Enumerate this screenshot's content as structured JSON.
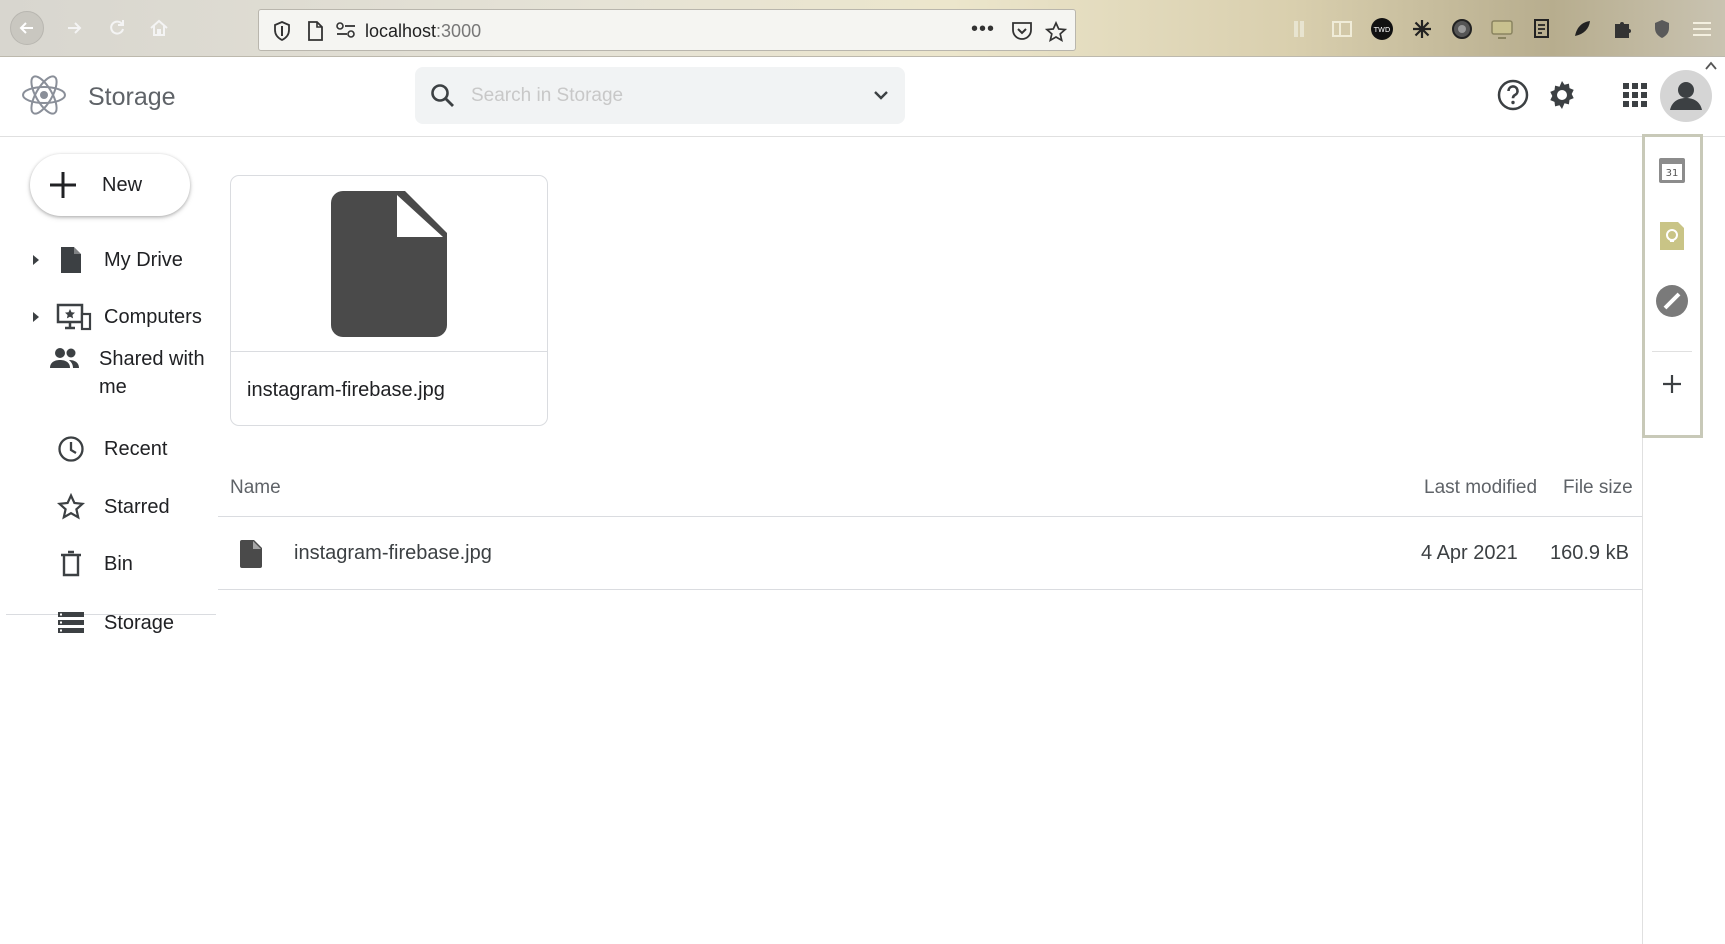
{
  "browser": {
    "url_host": "localhost",
    "url_port": ":3000",
    "menu_dots": "•••"
  },
  "app": {
    "title": "Storage",
    "search_placeholder": "Search in Storage"
  },
  "sidebar": {
    "new_label": "New",
    "items": [
      {
        "label": "My Drive",
        "icon": "drive-icon",
        "has_caret": true
      },
      {
        "label": "Computers",
        "icon": "computer-icon",
        "has_caret": true
      },
      {
        "label": "Shared with me",
        "icon": "people-icon",
        "has_caret": false
      },
      {
        "label": "Recent",
        "icon": "clock-icon",
        "has_caret": false
      },
      {
        "label": "Starred",
        "icon": "star-icon",
        "has_caret": false
      },
      {
        "label": "Bin",
        "icon": "trash-icon",
        "has_caret": false
      },
      {
        "label": "Storage",
        "icon": "storage-icon",
        "has_caret": false
      }
    ]
  },
  "main": {
    "card": {
      "file_name": "instagram-firebase.jpg"
    },
    "table": {
      "headers": {
        "name": "Name",
        "modified": "Last modified",
        "size": "File size"
      },
      "rows": [
        {
          "name": "instagram-firebase.jpg",
          "modified": "4 Apr 2021",
          "size": "160.9 kB"
        }
      ]
    }
  },
  "addons": {
    "calendar_day": "31",
    "add_symbol": "+"
  },
  "colors": {
    "icon_dark": "#4a4a4a",
    "text": "#202124",
    "muted": "#5f6368",
    "border": "#dadce0"
  }
}
